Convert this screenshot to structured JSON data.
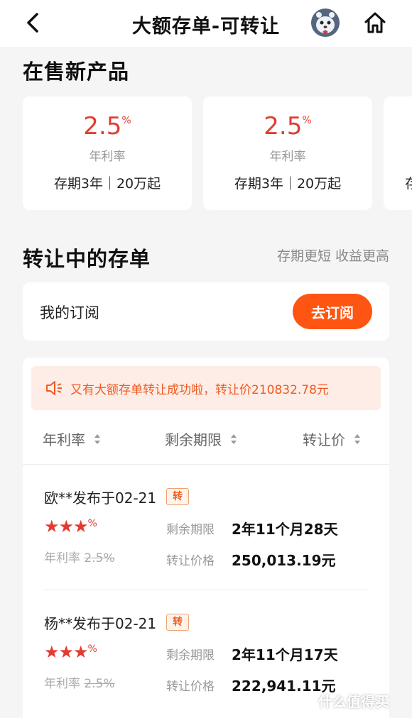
{
  "header": {
    "title": "大额存单-可转让",
    "back_icon": "chevron-left-icon",
    "home_icon": "home-icon"
  },
  "new_products": {
    "section_title": "在售新产品",
    "items": [
      {
        "rate": "2.5",
        "rate_unit": "%",
        "rate_label": "年利率",
        "term": "存期3年｜20万起"
      },
      {
        "rate": "2.5",
        "rate_unit": "%",
        "rate_label": "年利率",
        "term": "存期3年｜20万起"
      },
      {
        "rate": "",
        "rate_unit": "",
        "rate_label": "",
        "term": "存"
      }
    ]
  },
  "transfer": {
    "section_title": "转让中的存单",
    "subtitle": "存期更短 收益更高"
  },
  "subscribe": {
    "label": "我的订阅",
    "button": "去订阅"
  },
  "notice": {
    "text": "又有大额存单转让成功啦，转让价210832.78元"
  },
  "columns": {
    "rate": "年利率",
    "remaining": "剩余期限",
    "price": "转让价"
  },
  "listings": [
    {
      "title": "欧**发布于02-21",
      "tag": "转",
      "stars": "★★★",
      "stars_unit": "%",
      "rate_label": "年利率",
      "old_rate": "2.5%",
      "remaining_label": "剩余期限",
      "remaining": "2年11个月28天",
      "price_label": "转让价格",
      "price": "250,013.19元"
    },
    {
      "title": "杨**发布于02-21",
      "tag": "转",
      "stars": "★★★",
      "stars_unit": "%",
      "rate_label": "年利率",
      "old_rate": "2.5%",
      "remaining_label": "剩余期限",
      "remaining": "2年11个月17天",
      "price_label": "转让价格",
      "price": "222,941.11元"
    }
  ],
  "watermark": {
    "text": "什么值得买"
  },
  "colors": {
    "accent": "#ff5512",
    "rate_red": "#e23c32",
    "notice_bg": "#fdede6"
  }
}
